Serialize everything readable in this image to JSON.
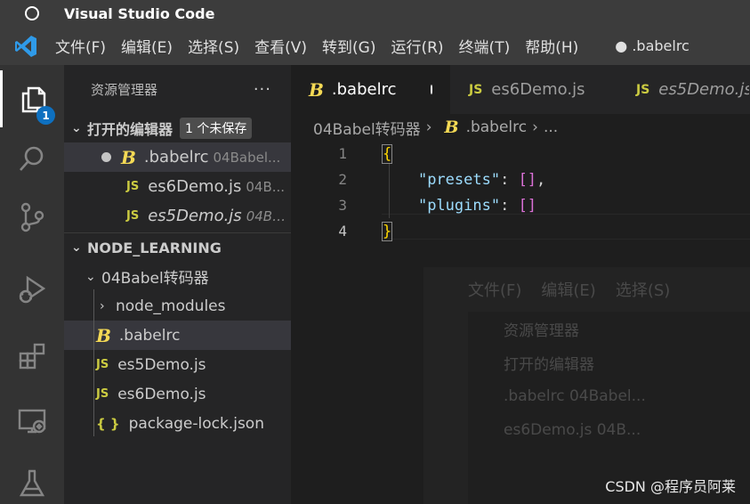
{
  "window": {
    "title": "Visual Studio Code"
  },
  "menu": {
    "items": [
      "文件(F)",
      "编辑(E)",
      "选择(S)",
      "查看(V)",
      "转到(G)",
      "运行(R)",
      "终端(T)",
      "帮助(H)"
    ],
    "dirty_title": "● .babelrc"
  },
  "activity": {
    "explorer_badge": "1"
  },
  "sidebar": {
    "header": "资源管理器",
    "more": "···",
    "open_editors": {
      "title": "打开的编辑器",
      "unsaved_badge": "1 个未保存",
      "items": [
        {
          "name": ".babelrc",
          "path": "04Babel..."
        },
        {
          "name": "es6Demo.js",
          "path": "04B..."
        },
        {
          "name": "es5Demo.js",
          "path": "04Ba..."
        }
      ]
    },
    "project": {
      "title": "NODE_LEARNING",
      "folder": "04Babel转码器",
      "children": {
        "node_modules": "node_modules",
        "babelrc": ".babelrc",
        "es5": "es5Demo.js",
        "es6": "es6Demo.js",
        "lock": "package-lock.json"
      }
    }
  },
  "editor": {
    "tabs": [
      {
        "label": ".babelrc"
      },
      {
        "label": "es6Demo.js"
      },
      {
        "label": "es5Demo.js"
      }
    ],
    "breadcrumb": {
      "folder": "04Babel转码器",
      "file": ".babelrc",
      "ellipsis": "..."
    },
    "lines": [
      {
        "num": "1",
        "open": "{"
      },
      {
        "num": "2",
        "key": "\"presets\"",
        "colon": ": ",
        "value": "[]",
        "comma": ","
      },
      {
        "num": "3",
        "key": "\"plugins\"",
        "colon": ": ",
        "value": "[]"
      },
      {
        "num": "4",
        "close": "}"
      }
    ]
  },
  "icons": {
    "js": "JS",
    "json": "{ }",
    "babel": "B"
  },
  "ghost": {
    "menu": [
      "文件(F)",
      "编辑(E)",
      "选择(S)"
    ],
    "header": "资源管理器",
    "section": "打开的编辑器",
    "file1": ".babelrc 04Babel...",
    "file2": "es6Demo.js 04B..."
  },
  "watermark": "CSDN @程序员阿莱"
}
